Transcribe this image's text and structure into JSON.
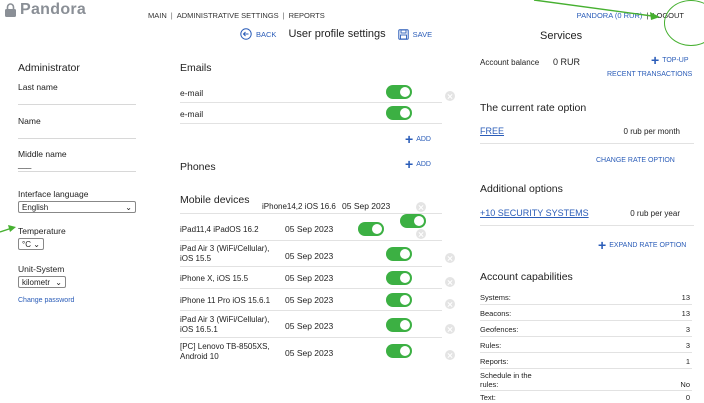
{
  "header": {
    "logo": "Pandora",
    "nav": [
      "MAIN",
      "ADMINISTRATIVE SETTINGS",
      "REPORTS"
    ],
    "user": "PANDORA (0 RUR)",
    "logout": "LOGOUT",
    "services": "Services"
  },
  "toolbar": {
    "back": "BACK",
    "title": "User profile settings",
    "save": "SAVE"
  },
  "left": {
    "section": "Administrator",
    "last_name": "Last name",
    "name": "Name",
    "middle_name": "Middle name",
    "middle_value": "___",
    "language_label": "Interface language",
    "language": "English",
    "temperature_label": "Temperature",
    "temperature": "°C",
    "unit_label": "Unit-System",
    "unit": "kilometr",
    "change_password": "Change password"
  },
  "emails": {
    "title": "Emails",
    "items": [
      "e-mail",
      "e-mail"
    ],
    "add": "ADD"
  },
  "phones": {
    "title": "Phones",
    "add": "ADD"
  },
  "mobile": {
    "title": "Mobile devices",
    "first_device": "iPhone14,2 iOS 16.6",
    "first_date": "05 Sep 2023",
    "devices": [
      {
        "name": "iPad11,4 iPadOS 16.2",
        "date": "05 Sep 2023"
      },
      {
        "name": "iPad Air 3 (WiFi/Cellular), iOS 15.5",
        "date": "05 Sep 2023"
      },
      {
        "name": "iPhone X, iOS 15.5",
        "date": "05 Sep 2023"
      },
      {
        "name": "iPhone 11 Pro iOS 15.6.1",
        "date": "05 Sep 2023"
      },
      {
        "name": "iPad Air 3 (WiFi/Cellular), iOS 16.5.1",
        "date": "05 Sep 2023"
      },
      {
        "name": "[PC] Lenovo TB-8505XS, Android 10",
        "date": "05 Sep 2023"
      }
    ]
  },
  "account": {
    "balance_label": "Account balance",
    "balance": "0 RUR",
    "topup": "TOP-UP",
    "recent": "RECENT TRANSACTIONS",
    "rate_title": "The current rate option",
    "rate_name": "FREE",
    "rate_price": "0 rub per month",
    "change_rate": "CHANGE RATE OPTION",
    "options_title": "Additional options",
    "option_name": "+10 SECURITY SYSTEMS",
    "option_price": "0 rub per year",
    "expand_rate": "EXPAND RATE OPTION",
    "capabilities_title": "Account capabilities",
    "capabilities": [
      {
        "label": "Systems:",
        "value": "13"
      },
      {
        "label": "Beacons:",
        "value": "13"
      },
      {
        "label": "Geofences:",
        "value": "3"
      },
      {
        "label": "Rules:",
        "value": "3"
      },
      {
        "label": "Reports:",
        "value": "1"
      },
      {
        "label": "Schedule in the rules:",
        "value": "No"
      },
      {
        "label": "Text:",
        "value": "0"
      }
    ]
  },
  "colors": {
    "accent": "#2a5cb8",
    "toggle": "#3cb043",
    "annotation": "#46b030"
  }
}
